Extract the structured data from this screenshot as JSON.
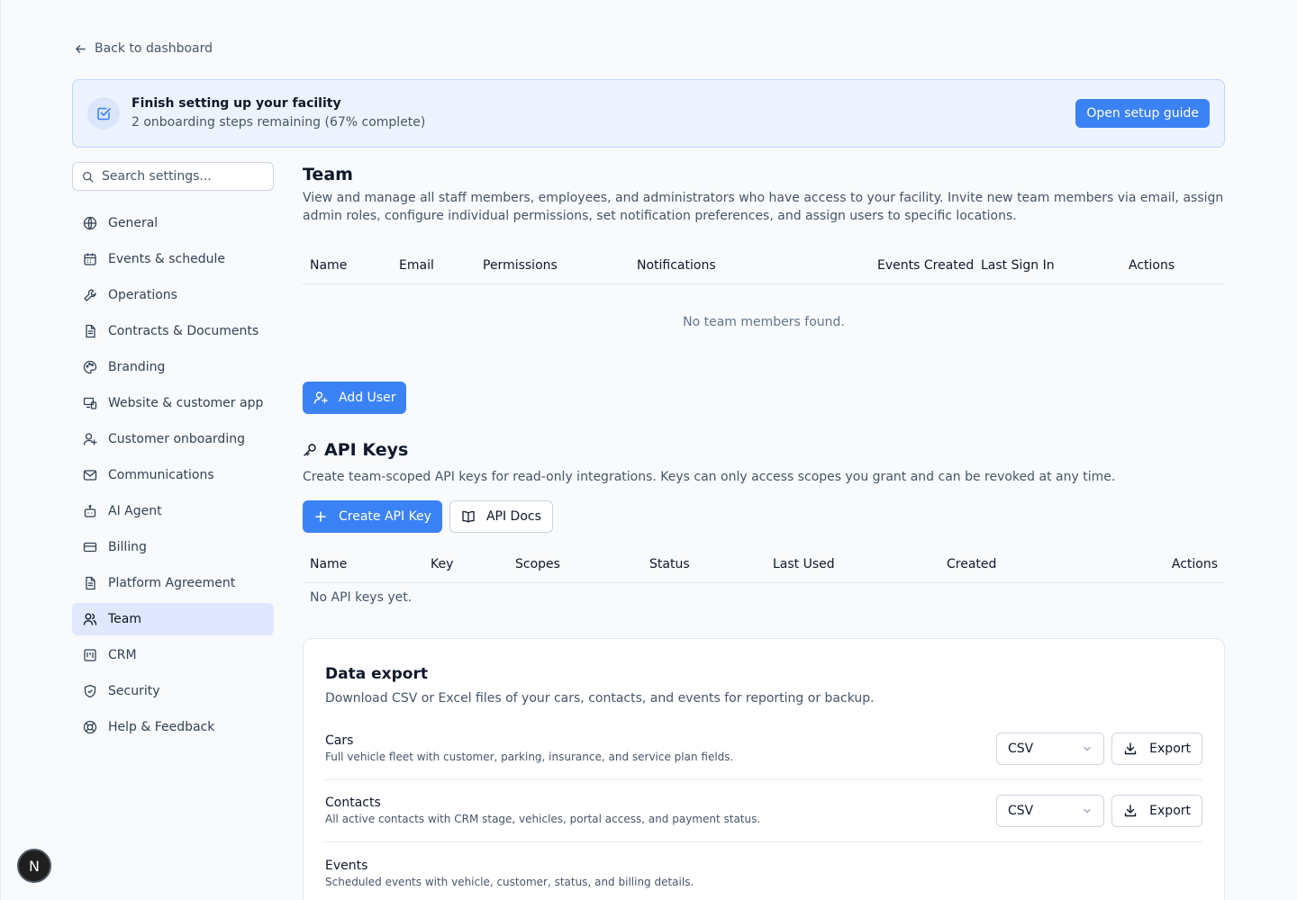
{
  "back_link": "Back to dashboard",
  "banner": {
    "title": "Finish setting up your facility",
    "subtitle": "2 onboarding steps remaining (67% complete)",
    "button": "Open setup guide"
  },
  "search": {
    "placeholder": "Search settings..."
  },
  "sidebar": {
    "items": [
      {
        "label": "General",
        "icon": "globe-icon"
      },
      {
        "label": "Events & schedule",
        "icon": "calendar-icon"
      },
      {
        "label": "Operations",
        "icon": "wrench-icon"
      },
      {
        "label": "Contracts & Documents",
        "icon": "document-icon"
      },
      {
        "label": "Branding",
        "icon": "palette-icon"
      },
      {
        "label": "Website & customer app",
        "icon": "devices-icon"
      },
      {
        "label": "Customer onboarding",
        "icon": "user-plus-icon"
      },
      {
        "label": "Communications",
        "icon": "mail-icon"
      },
      {
        "label": "AI Agent",
        "icon": "bot-icon"
      },
      {
        "label": "Billing",
        "icon": "credit-card-icon"
      },
      {
        "label": "Platform Agreement",
        "icon": "document-icon"
      },
      {
        "label": "Team",
        "icon": "users-icon",
        "active": true
      },
      {
        "label": "CRM",
        "icon": "kanban-icon"
      },
      {
        "label": "Security",
        "icon": "shield-icon"
      },
      {
        "label": "Help & Feedback",
        "icon": "lifebuoy-icon"
      }
    ]
  },
  "team": {
    "title": "Team",
    "description": "View and manage all staff members, employees, and administrators who have access to your facility. Invite new team members via email, assign admin roles, configure individual permissions, set notification preferences, and assign users to specific locations.",
    "columns": [
      "Name",
      "Email",
      "Permissions",
      "Notifications",
      "Events Created",
      "Last Sign In",
      "Actions"
    ],
    "empty": "No team members found.",
    "add_button": "Add User"
  },
  "api_keys": {
    "title": "API Keys",
    "description": "Create team-scoped API keys for read-only integrations. Keys can only access scopes you grant and can be revoked at any time.",
    "create_button": "Create API Key",
    "docs_button": "API Docs",
    "columns": [
      "Name",
      "Key",
      "Scopes",
      "Status",
      "Last Used",
      "Created",
      "Actions"
    ],
    "empty": "No API keys yet."
  },
  "data_export": {
    "title": "Data export",
    "description": "Download CSV or Excel files of your cars, contacts, and events for reporting or backup.",
    "rows": [
      {
        "name": "Cars",
        "description": "Full vehicle fleet with customer, parking, insurance, and service plan fields.",
        "format": "CSV",
        "button": "Export"
      },
      {
        "name": "Contacts",
        "description": "All active contacts with CRM stage, vehicles, portal access, and payment status.",
        "format": "CSV",
        "button": "Export"
      },
      {
        "name": "Events",
        "description": "Scheduled events with vehicle, customer, status, and billing details."
      }
    ]
  },
  "fab": {
    "label": "N"
  },
  "colors": {
    "accent": "#3b82f6",
    "banner_bg": "#eef4ff",
    "active_nav": "#e0e7ff"
  }
}
